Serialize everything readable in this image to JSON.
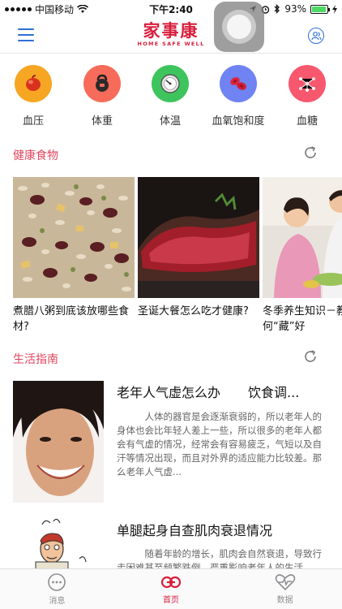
{
  "status_bar": {
    "carrier": "中国移动",
    "time": "下午2:40",
    "battery": "93%",
    "battery_level": 0.93
  },
  "header": {
    "logo_text": "家事康",
    "logo_subtext": "HOME SAFE WELL"
  },
  "categories": [
    {
      "label": "血压",
      "color": "#f6a623",
      "icon": "blood-pressure-icon"
    },
    {
      "label": "体重",
      "color": "#f76b5a",
      "icon": "kettlebell-icon"
    },
    {
      "label": "体温",
      "color": "#3ec45c",
      "icon": "thermometer-icon"
    },
    {
      "label": "血氧饱和度",
      "color": "#6f83f2",
      "icon": "blood-cells-icon"
    },
    {
      "label": "血糖",
      "color": "#f7586e",
      "icon": "molecule-icon"
    }
  ],
  "healthy_food": {
    "title": "健康食物",
    "items": [
      {
        "title": "煮腊八粥到底该放哪些食材?"
      },
      {
        "title": "圣诞大餐怎么吃才健康?"
      },
      {
        "title": "冬季养生知识－教你如何“藏”好"
      }
    ]
  },
  "life_guide": {
    "title": "生活指南",
    "articles": [
      {
        "title": "老年人气虚怎么办",
        "title_2": "饮食调...",
        "body": "人体的器官是会逐渐衰弱的，所以老年人的身体也会比年轻人差上一些，所以很多的老年人都会有气虚的情况，经常会有容易疲乏，气短以及自汗等情况出现，而且对外界的适应能力比较差。那么老年人气虚..."
      },
      {
        "title": "单腿起身自查肌肉衰退情况",
        "body": "随着年龄的增长，肌肉会自然衰退，导致行走困难甚至频繁跌倒，严重影响老年人的生活"
      }
    ]
  },
  "tabs": [
    {
      "label": "消息",
      "active": false
    },
    {
      "label": "首页",
      "active": true
    },
    {
      "label": "数据",
      "active": false
    }
  ],
  "colors": {
    "accent_red": "#d81e3c",
    "section_red": "#e0455e",
    "nav_blue": "#2f6fd6",
    "tab_inactive": "#8e8e93"
  }
}
